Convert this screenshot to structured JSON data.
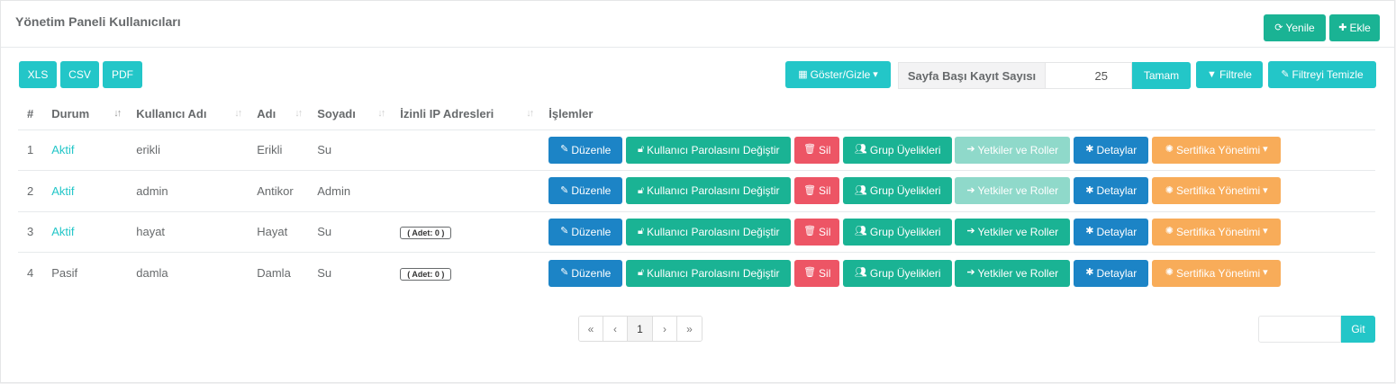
{
  "header": {
    "title": "Yönetim Paneli Kullanıcıları",
    "refresh_label": "Yenile",
    "add_label": "Ekle"
  },
  "export": {
    "xls": "XLS",
    "csv": "CSV",
    "pdf": "PDF"
  },
  "toolbar": {
    "show_hide_label": "Göster/Gizle",
    "page_size_label": "Sayfa Başı Kayıt Sayısı",
    "page_size_value": "25",
    "ok_label": "Tamam",
    "filter_label": "Filtrele",
    "clear_filter_label": "Filtreyi Temizle"
  },
  "table": {
    "headers": [
      "#",
      "Durum",
      "Kullanıcı Adı",
      "Adı",
      "Soyadı",
      "İzinli IP Adresleri",
      "İşlemler"
    ],
    "rows": [
      {
        "no": "1",
        "status": "Aktif",
        "username": "erikli",
        "name": "Erikli",
        "surname": "Su",
        "ip": ""
      },
      {
        "no": "2",
        "status": "Aktif",
        "username": "admin",
        "name": "Antikor",
        "surname": "Admin",
        "ip": ""
      },
      {
        "no": "3",
        "status": "Aktif",
        "username": "hayat",
        "name": "Hayat",
        "surname": "Su",
        "ip": "( Adet: 0 )"
      },
      {
        "no": "4",
        "status": "Pasif",
        "username": "damla",
        "name": "Damla",
        "surname": "Su",
        "ip": "( Adet: 0 )"
      }
    ]
  },
  "actions": {
    "edit": "Düzenle",
    "change_password": "Kullanıcı Parolasını Değiştir",
    "delete": "Sil",
    "groups": "Grup Üyelikleri",
    "roles": "Yetkiler ve Roller",
    "details": "Detaylar",
    "certificate": "Sertifika Yönetimi"
  },
  "pagination": {
    "first": "«",
    "prev": "‹",
    "current": "1",
    "next": "›",
    "last": "»"
  },
  "goto": {
    "value": "",
    "button": "Git"
  },
  "colors": {
    "green": "#1ab394",
    "cyan": "#23c6c8",
    "blue": "#1c84c6",
    "red": "#ed5565",
    "orange": "#f8ac59"
  }
}
